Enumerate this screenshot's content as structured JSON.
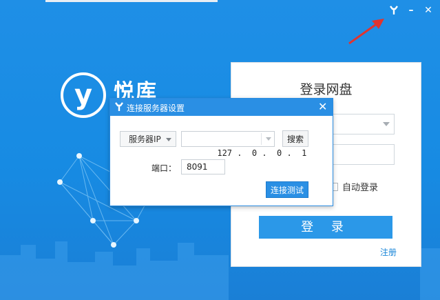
{
  "window": {
    "settings_icon": "wrench-icon",
    "minimize_label": "–",
    "close_label": "✕"
  },
  "brand": {
    "logo_letter": "y",
    "name": "悦库"
  },
  "login": {
    "title": "登录网盘",
    "server_select_value": "",
    "password_value": "",
    "auto_login_label": "自动登录",
    "login_button_label": "登 录",
    "register_link": "注册"
  },
  "dialog": {
    "title": "连接服务器设置",
    "close_label": "✕",
    "server_type_value": "服务器IP",
    "ip_value": "127 .  0 .  0 .  1",
    "search_button_label": "搜索",
    "port_label": "端口：",
    "port_value": "8091",
    "test_button_label": "连接测试"
  },
  "colors": {
    "background": "#1f8fe6",
    "accent": "#2a8fe4",
    "annotation_arrow": "#e0342f"
  }
}
